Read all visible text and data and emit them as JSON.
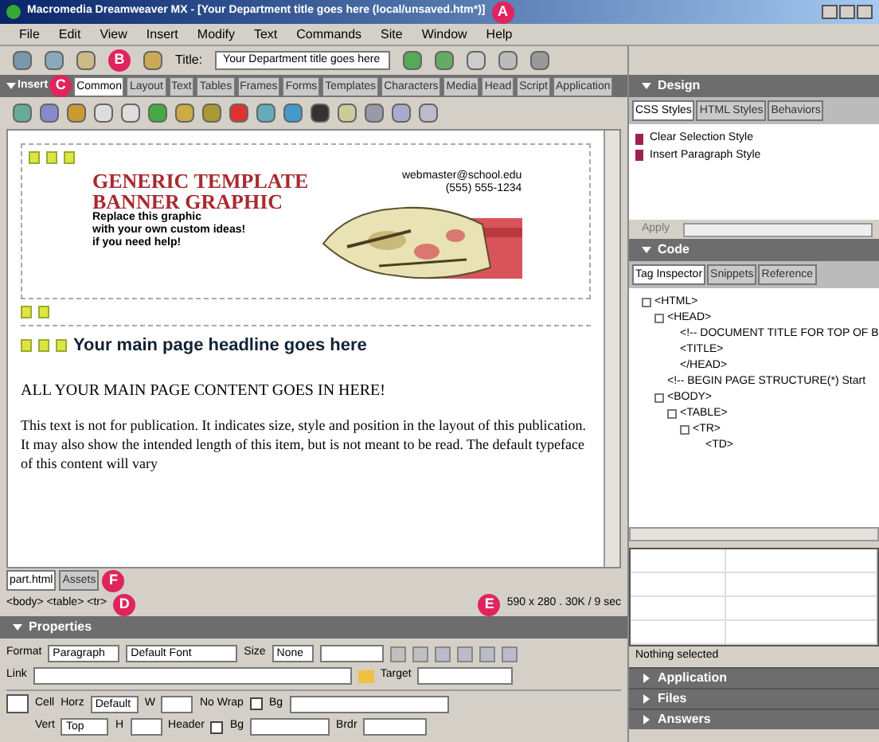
{
  "window": {
    "title": "Macromedia Dreamweaver MX - [Your Department title goes here (local/unsaved.htm*)]"
  },
  "menu": [
    "File",
    "Edit",
    "View",
    "Insert",
    "Modify",
    "Text",
    "Commands",
    "Site",
    "Window",
    "Help"
  ],
  "toolbar": {
    "title_label": "Title:",
    "title_value": "Your Department title goes here"
  },
  "insert_bar": {
    "header": "Insert",
    "tabs": [
      {
        "label": "Common",
        "selected": true
      },
      {
        "label": "Layout",
        "selected": false
      },
      {
        "label": "Text",
        "selected": false
      },
      {
        "label": "Tables",
        "selected": false
      },
      {
        "label": "Frames",
        "selected": false
      },
      {
        "label": "Forms",
        "selected": false
      },
      {
        "label": "Templates",
        "selected": false
      },
      {
        "label": "Characters",
        "selected": false
      },
      {
        "label": "Media",
        "selected": false
      },
      {
        "label": "Head",
        "selected": false
      },
      {
        "label": "Script",
        "selected": false
      },
      {
        "label": "Application",
        "selected": false
      }
    ]
  },
  "document": {
    "banner_title": [
      "GENERIC TEMPLATE",
      "BANNER GRAPHIC"
    ],
    "banner_lines": [
      "Replace this graphic",
      "with your own custom ideas!",
      "if you need help!"
    ],
    "contact": [
      "webmaster@school.edu",
      "(555) 555-1234"
    ],
    "headline": "Your main page headline goes here",
    "subhead": "ALL YOUR MAIN PAGE CONTENT GOES IN HERE!",
    "body": "This text is not for publication. It indicates size, style and position in the layout of this publication. It may also show the intended length of this item, but is not meant to be read. The default typeface of this content will vary"
  },
  "doc_tabs": [
    {
      "label": "part.html",
      "selected": true
    },
    {
      "label": "Assets",
      "selected": false
    }
  ],
  "status_bar": {
    "tags": "<body> <table> <tr>",
    "size": "590 x 280 . 30K / 9 sec"
  },
  "properties": {
    "header": "Properties",
    "format_label": "Format",
    "format": "Paragraph",
    "font": "Default Font",
    "size_label": "Size",
    "size": "None",
    "link_label": "Link",
    "target_label": "Target",
    "cell_label": "Cell",
    "horz_label": "Horz",
    "horz": "Default",
    "w_label": "W",
    "nowrap_label": "No Wrap",
    "nowrap_checked": false,
    "bg_label": "Bg",
    "vert_label": "Vert",
    "vert": "Top",
    "h_label": "H",
    "header_label": "Header",
    "header_checked": false,
    "bg2_label": "Bg",
    "brdr_label": "Brdr"
  },
  "design_panel": {
    "header": "Design",
    "tabs": [
      {
        "label": "CSS Styles",
        "selected": true
      },
      {
        "label": "HTML Styles",
        "selected": false
      },
      {
        "label": "Behaviors",
        "selected": false
      }
    ],
    "items": [
      "Clear Selection Style",
      "Insert Paragraph Style"
    ],
    "apply": "Apply"
  },
  "code_panel": {
    "header": "Code",
    "tabs": [
      {
        "label": "Tag Inspector",
        "selected": true
      },
      {
        "label": "Snippets",
        "selected": false
      },
      {
        "label": "Reference",
        "selected": false
      }
    ],
    "tree": [
      {
        "label": "<HTML>",
        "children": [
          {
            "label": "<HEAD>",
            "children": [
              {
                "label": "<!-- DOCUMENT TITLE FOR TOP OF B"
              },
              {
                "label": "<TITLE>"
              },
              {
                "label": "</HEAD>"
              }
            ]
          },
          {
            "label": "<!-- BEGIN PAGE STRUCTURE(*) Start"
          },
          {
            "label": "<BODY>",
            "children": [
              {
                "label": "<TABLE>",
                "children": [
                  {
                    "label": "<TR>",
                    "children": [
                      {
                        "label": "<TD>"
                      }
                    ]
                  }
                ]
              }
            ]
          }
        ]
      }
    ]
  },
  "selection": "Nothing selected",
  "collapsed_panels": [
    "Application",
    "Files",
    "Answers"
  ],
  "callouts": [
    "A",
    "B",
    "C",
    "D",
    "E",
    "F"
  ]
}
